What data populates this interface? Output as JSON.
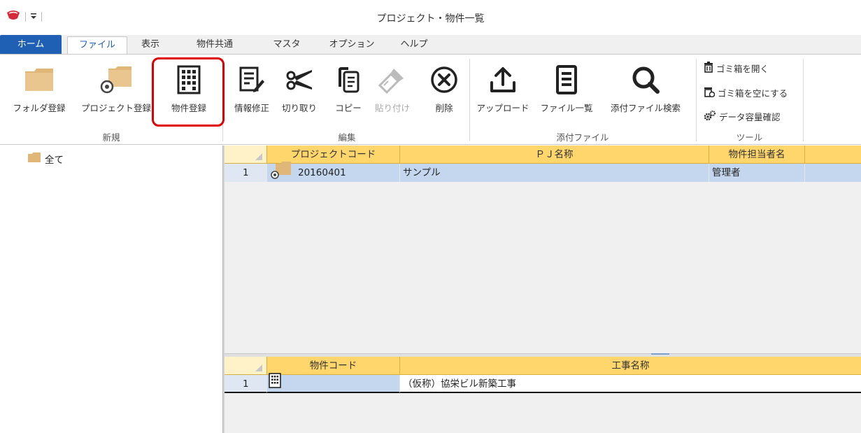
{
  "window": {
    "title": "プロジェクト・物件一覧"
  },
  "tabs": [
    "ホーム",
    "ファイル",
    "表示",
    "物件共通",
    "マスタ",
    "オプション",
    "ヘルプ"
  ],
  "ribbon": {
    "new_group": {
      "label": "新規",
      "buttons": [
        "フォルダ登録",
        "プロジェクト登録",
        "物件登録"
      ]
    },
    "edit_group": {
      "label": "編集",
      "buttons": [
        "情報修正",
        "切り取り",
        "コピー",
        "貼り付け",
        "削除"
      ]
    },
    "attach_group": {
      "label": "添付ファイル",
      "buttons": [
        "アップロード",
        "ファイル一覧",
        "添付ファイル検索"
      ]
    },
    "tools_group": {
      "label": "ツール",
      "buttons": [
        "ゴミ箱を開く",
        "ゴミ箱を空にする",
        "データ容量確認"
      ]
    }
  },
  "tree": {
    "root_label": "全て"
  },
  "project_grid": {
    "columns": [
      "プロジェクトコード",
      "ＰＪ名称",
      "物件担当者名"
    ],
    "rows": [
      {
        "num": "1",
        "code": "20160401",
        "name": "サンプル",
        "manager": "管理者"
      }
    ]
  },
  "property_grid": {
    "columns": [
      "物件コード",
      "工事名称"
    ],
    "rows": [
      {
        "num": "1",
        "code": "",
        "name": "（仮称）協栄ビル新築工事"
      }
    ]
  },
  "colors": {
    "accent": "#1f5fb4",
    "header": "#ffd66b",
    "folder": "#e0b776",
    "highlight": "#e00000",
    "selected_row": "#c5d7ee"
  }
}
